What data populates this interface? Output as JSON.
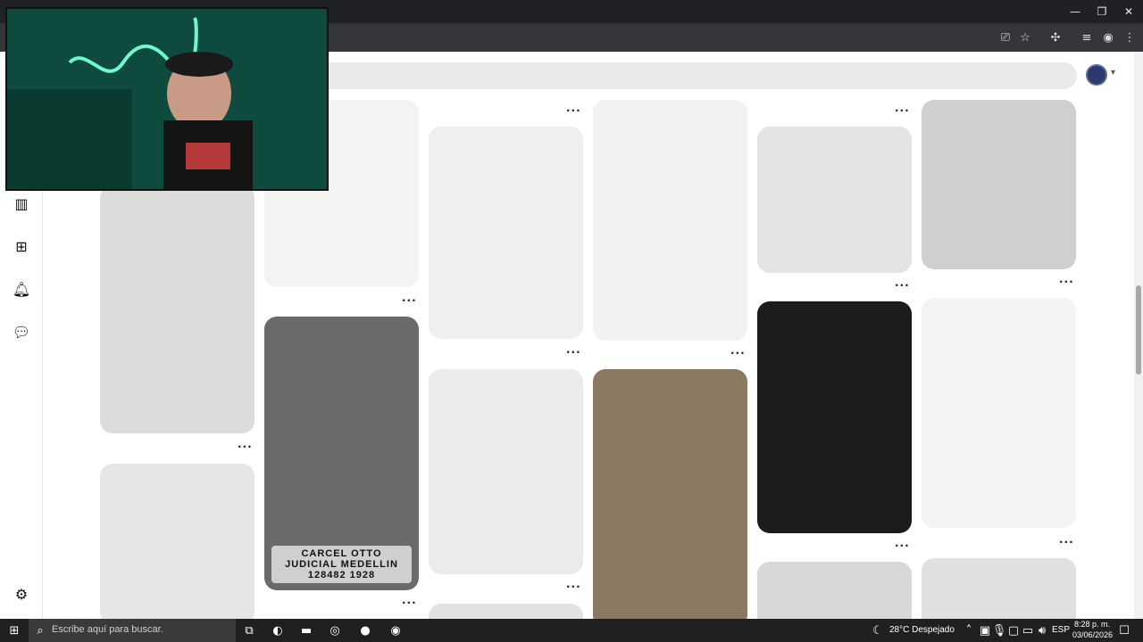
{
  "browser": {
    "window_controls": {
      "minimize": "—",
      "restore": "❐",
      "close": "✕"
    }
  },
  "page": {
    "sidebar_icons": [
      "layout-icon",
      "create-icon",
      "notifications-icon",
      "messages-icon",
      "settings-icon"
    ]
  },
  "pins": [
    {
      "caption": "CARCEL OTTO JUDICIAL MEDELLIN 128482 1928"
    }
  ],
  "taskbar": {
    "search_placeholder": "Escribe aquí para buscar.",
    "weather": "28°C  Despejado",
    "language": "ESP",
    "time": "8:28 p. m.",
    "date": "03/06/2026"
  },
  "colors": {
    "accent": "#e60023",
    "background": "#ffffff",
    "taskbar": "#202020"
  }
}
